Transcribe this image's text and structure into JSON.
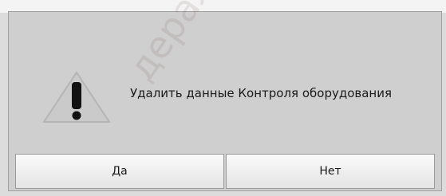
{
  "dialog": {
    "message": "Удалить данные Контроля оборудования",
    "buttons": {
      "yes": "Да",
      "no": "Нет"
    },
    "icon": "warning-icon"
  },
  "watermark": "дерально",
  "colors": {
    "dialog_bg": "#cfcfcf",
    "warning_triangle": "#c9c9c9",
    "exclamation": "#111111"
  }
}
